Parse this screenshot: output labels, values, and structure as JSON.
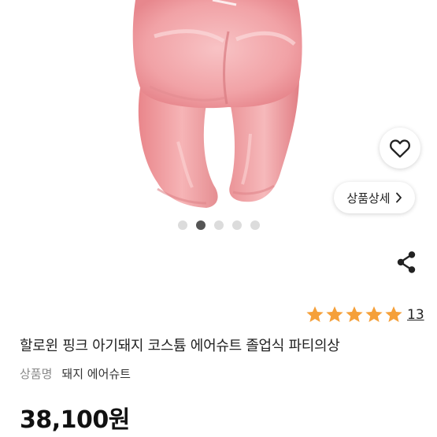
{
  "product_image": {
    "slide_count": 5,
    "active_slide_index": 1
  },
  "wishlist": {
    "icon": "heart-outline-icon"
  },
  "detail_button": {
    "label": "상품상세",
    "icon": "chevron-right-icon"
  },
  "share": {
    "icon": "share-icon"
  },
  "rating": {
    "stars": 5,
    "max_stars": 5,
    "review_count": "13",
    "star_color": "#f5a03a"
  },
  "product": {
    "title": "할로윈 핑크 아기돼지 코스튬 에어슈트 졸업식 파티의상",
    "spec_label": "상품명",
    "spec_value": "돼지 에어슈트",
    "price": "38,100원"
  },
  "colors": {
    "suit_pink": "#f2a3a6",
    "text_dark": "#222222",
    "text_muted": "#888888"
  }
}
